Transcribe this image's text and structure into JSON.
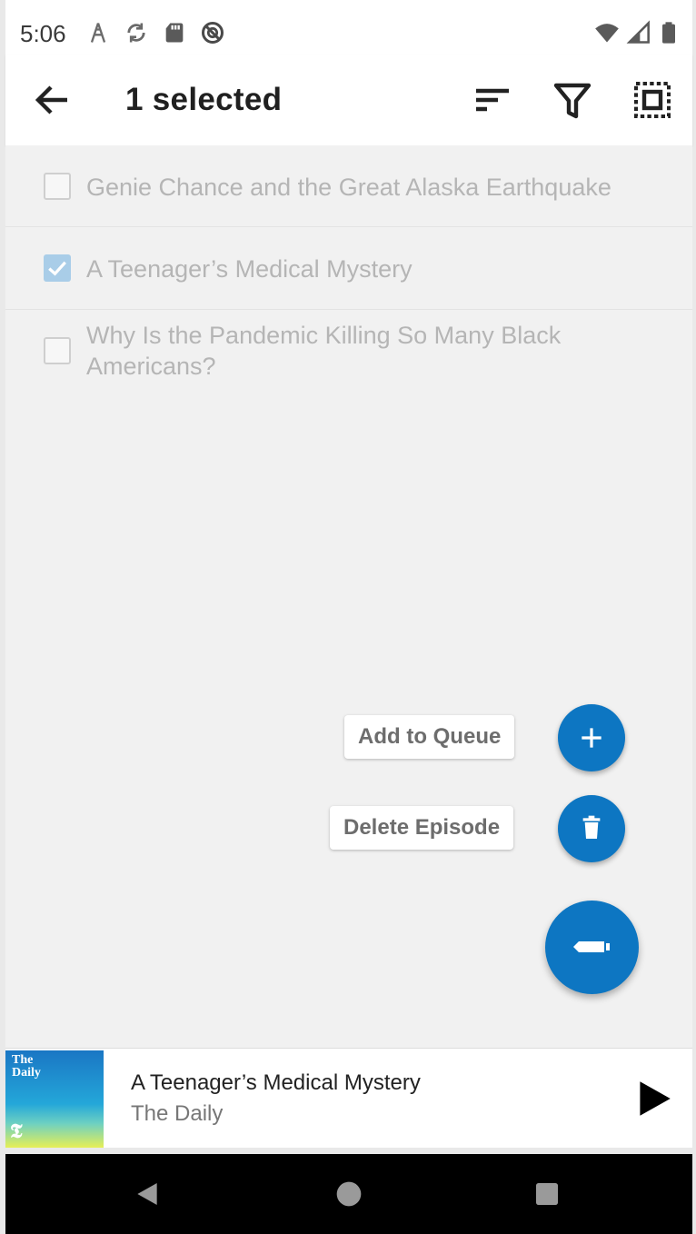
{
  "status_bar": {
    "time": "5:06",
    "left_icons": [
      "network-activity-icon",
      "sync-icon",
      "sd-card-icon",
      "do-not-disturb-icon"
    ],
    "right_icons": [
      "wifi-icon",
      "cellular-signal-icon",
      "battery-icon"
    ]
  },
  "app_bar": {
    "title": "1 selected",
    "actions": [
      "sort-icon",
      "filter-icon",
      "select-all-icon"
    ]
  },
  "episodes": [
    {
      "title": "Genie Chance and the Great Alaska Earthquake",
      "checked": false
    },
    {
      "title": "A Teenager’s Medical Mystery",
      "checked": true
    },
    {
      "title": "Why Is the Pandemic Killing So Many Black Americans?",
      "checked": false
    }
  ],
  "speed_dial": {
    "add_to_queue": "Add to Queue",
    "delete_episode": "Delete Episode"
  },
  "now_playing": {
    "cover_text": "The Daily",
    "title": "A Teenager’s Medical Mystery",
    "podcast": "The Daily"
  },
  "colors": {
    "accent": "#0d76c2",
    "checkbox_checked": "#a9cde8",
    "list_background": "#f1f1f1"
  }
}
